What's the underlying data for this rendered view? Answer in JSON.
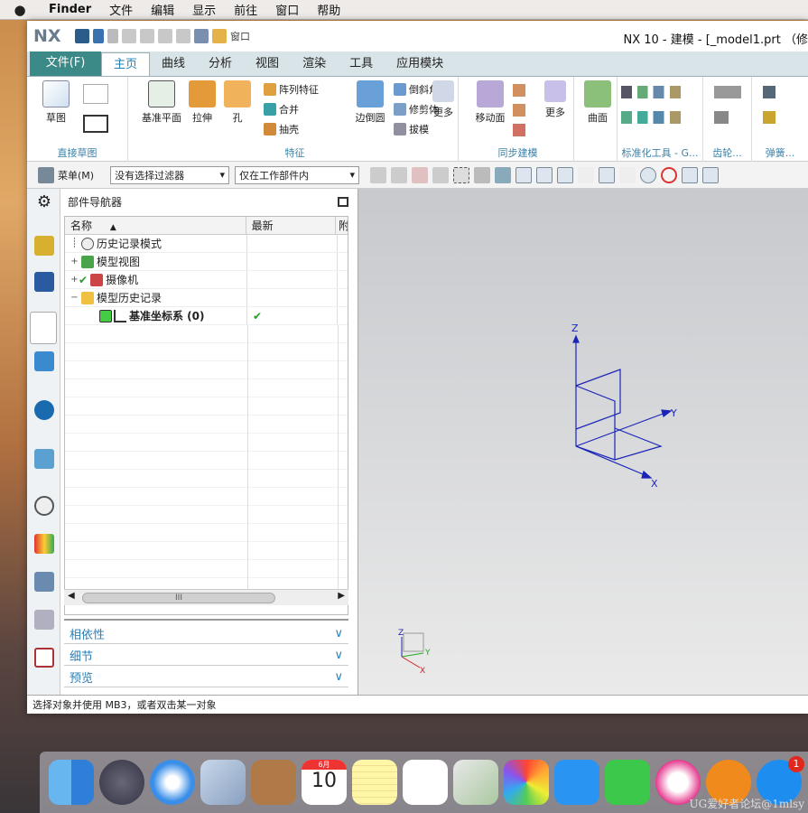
{
  "menubar": {
    "apple": "",
    "items": [
      "Finder",
      "文件",
      "编辑",
      "显示",
      "前往",
      "窗口",
      "帮助"
    ]
  },
  "title": {
    "logo": "NX",
    "window_menu": "窗口",
    "text": "NX 10 - 建模 - [_model1.prt （修"
  },
  "tabs": [
    "文件(F)",
    "主页",
    "曲线",
    "分析",
    "视图",
    "渲染",
    "工具",
    "应用模块"
  ],
  "ribbon": {
    "sketch": {
      "big": "草图",
      "label": "直接草图"
    },
    "feature": {
      "datum": "基准平面",
      "extrude": "拉伸",
      "hole": "孔",
      "pattern": "阵列特征",
      "unite": "合并",
      "shell": "抽壳",
      "edge_blend": "边倒圆",
      "chamfer": "倒斜角",
      "trim": "修剪体",
      "draft": "拔模",
      "more": "更多",
      "label": "特征"
    },
    "sync": {
      "move": "移动面",
      "more": "更多",
      "label": "同步建模"
    },
    "surface": {
      "face": "曲面"
    },
    "std_label": "标准化工具 - G...",
    "gear_label": "齿轮...",
    "spring_label": "弹簧..."
  },
  "toolbar2": {
    "menu": "菜单(M)",
    "filter": "没有选择过滤器",
    "scope": "仅在工作部件内"
  },
  "nav": {
    "title": "部件导航器",
    "col_name": "名称",
    "col_latest": "最新",
    "col3": "附",
    "rows": [
      {
        "name": "历史记录模式",
        "latest": ""
      },
      {
        "name": "模型视图",
        "latest": ""
      },
      {
        "name": "摄像机",
        "latest": ""
      },
      {
        "name": "模型历史记录",
        "latest": ""
      },
      {
        "name": "基准坐标系 (0)",
        "latest": "✔"
      }
    ],
    "scroll": "III",
    "sections": [
      "相依性",
      "细节",
      "预览"
    ]
  },
  "status": "选择对象并使用 MB3，或者双击某一对象",
  "axes": {
    "z": "Z",
    "y": "Y",
    "x": "X"
  },
  "dock": {
    "calendar_month": "6月",
    "calendar_day": "10",
    "appstore_badge": "1"
  },
  "watermark": "UG爱好者论坛@1mlsy"
}
